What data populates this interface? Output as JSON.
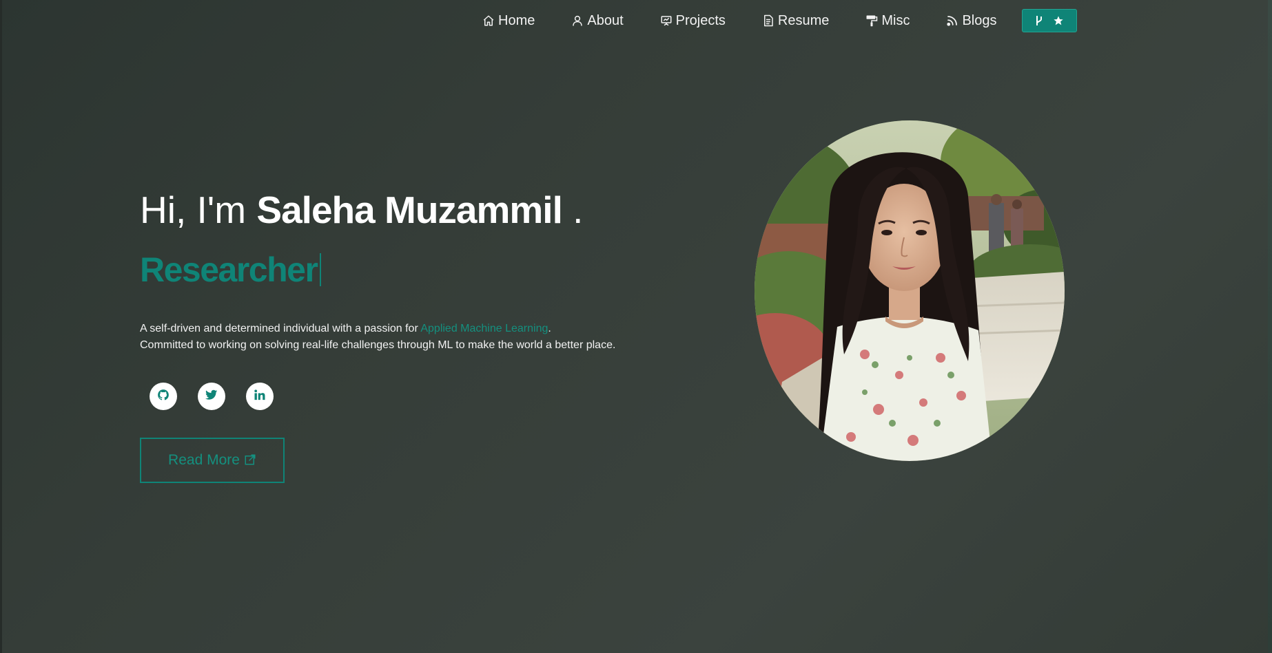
{
  "nav": {
    "items": [
      {
        "label": "Home",
        "icon": "home-icon"
      },
      {
        "label": "About",
        "icon": "user-icon"
      },
      {
        "label": "Projects",
        "icon": "presentation-icon"
      },
      {
        "label": "Resume",
        "icon": "document-icon"
      },
      {
        "label": "Misc",
        "icon": "paint-roller-icon"
      },
      {
        "label": "Blogs",
        "icon": "rss-icon"
      }
    ],
    "star_button": {
      "icons": [
        "git-branch-icon",
        "star-icon"
      ]
    }
  },
  "hero": {
    "greeting": "Hi, I'm ",
    "name": "Saleha Muzammil",
    "name_suffix": " .",
    "role": "Researcher",
    "bio_line1_prefix": "A self-driven and determined individual with a passion for ",
    "bio_highlight": "Applied Machine Learning",
    "bio_line1_suffix": ".",
    "bio_line2": "Committed to working on solving real-life challenges through ML to make the world a better place.",
    "socials": [
      "github-icon",
      "twitter-icon",
      "linkedin-icon"
    ],
    "read_more": "Read More"
  },
  "colors": {
    "accent": "#0f8477",
    "background": "#353d38",
    "text": "#ffffff"
  }
}
